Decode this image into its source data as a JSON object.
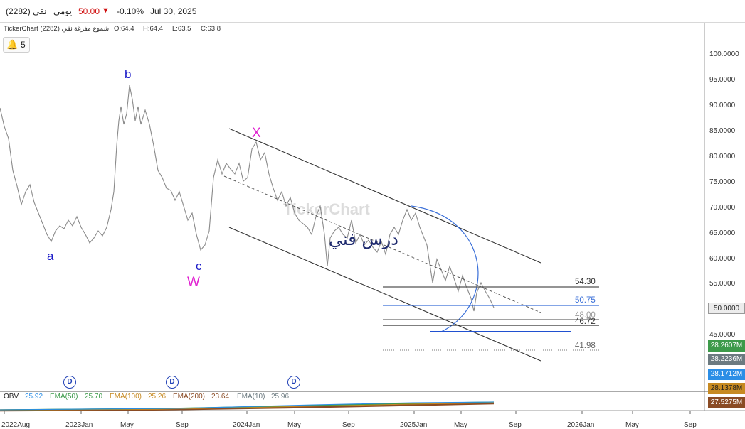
{
  "header": {
    "symbol": "نقي (2282)",
    "period": "يومي",
    "last_price": "50.00",
    "change_arrow": "▼",
    "change_pct": "-0.10%",
    "date": "Jul 30, 2025"
  },
  "info": {
    "source": "TickerChart نقي (2282)",
    "chart_type": "شموع مفرغة",
    "open": "O:64.4",
    "high": "H:64.4",
    "low": "L:63.5",
    "close": "C:63.8"
  },
  "alerts": {
    "count": "5"
  },
  "watermark": "TickerChart",
  "annotation_text": "درس فني",
  "wave_labels": {
    "a": "a",
    "b": "b",
    "c": "c",
    "W": "W",
    "X": "X"
  },
  "levels": {
    "l1": "54.30",
    "l2": "50.75",
    "l3": "48.00",
    "l4": "46.72",
    "l5": "41.98"
  },
  "price_axis": [
    "100.0000",
    "95.0000",
    "90.0000",
    "85.0000",
    "80.0000",
    "75.0000",
    "70.0000",
    "65.0000",
    "60.0000",
    "55.0000",
    "45.0000"
  ],
  "current_price_tag": "50.0000",
  "obv_tags": [
    "28.2607M",
    "28.2236M",
    "28.1712M",
    "28.1378M",
    "27.5275M"
  ],
  "obv_tag_colors": [
    "#3d9a4a",
    "#6c7a80",
    "#2b8ee6",
    "#c78a22",
    "#8a4b24"
  ],
  "time_axis": [
    "2022Aug",
    "2023Jan",
    "May",
    "Sep",
    "2024Jan",
    "May",
    "Sep",
    "2025Jan",
    "May",
    "Sep",
    "2026Jan",
    "May",
    "Sep"
  ],
  "dividend_marker": "D",
  "obv": {
    "label": "OBV",
    "obv_value": "25.92",
    "ema50_label": "EMA(50)",
    "ema50_value": "25.70",
    "ema100_label": "EMA(100)",
    "ema100_value": "25.26",
    "ema200_label": "EMA(200)",
    "ema200_value": "23.64",
    "ema10_label": "EMA(10)",
    "ema10_value": "25.96"
  },
  "colors": {
    "price_line": "#8a8a8a",
    "channel": "#333333",
    "wave_blue": "#1a1ac8",
    "wave_magenta": "#e020d0",
    "level_blue": "#3a6fd8",
    "down_red": "#d01010",
    "current_tag": "#ececec"
  }
}
